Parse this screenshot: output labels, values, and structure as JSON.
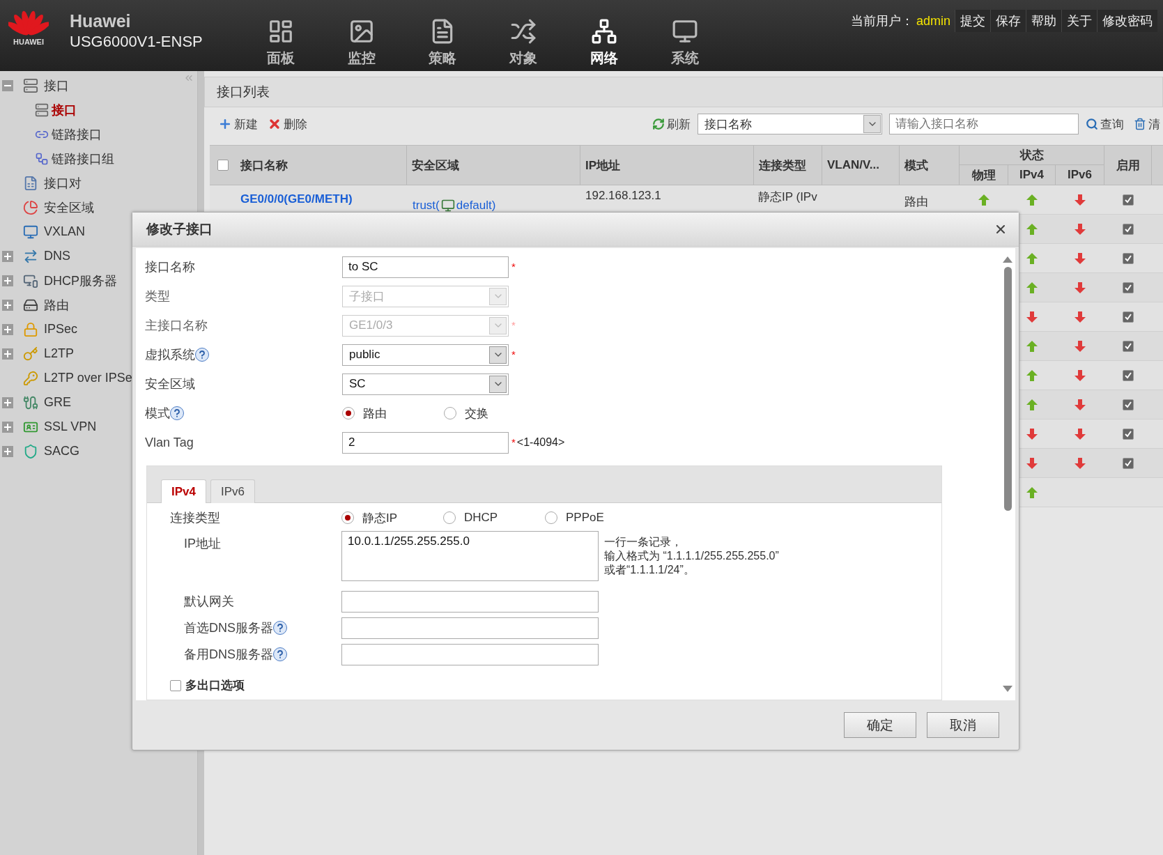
{
  "header": {
    "brand": "HUAWEI",
    "title": "Huawei",
    "model": "USG6000V1-ENSP",
    "nav": [
      {
        "label": "面板",
        "selected": false
      },
      {
        "label": "监控",
        "selected": false
      },
      {
        "label": "策略",
        "selected": false
      },
      {
        "label": "对象",
        "selected": false
      },
      {
        "label": "网络",
        "selected": true
      },
      {
        "label": "系统",
        "selected": false
      }
    ],
    "user_label": "当前用户：",
    "user": "admin",
    "links": [
      "提交",
      "保存",
      "帮助",
      "关于",
      "修改密码"
    ]
  },
  "sidebar": {
    "items": [
      {
        "label": "接口",
        "expanded": true,
        "selected": false,
        "children": [
          {
            "label": "接口",
            "selected": true
          },
          {
            "label": "链路接口",
            "selected": false
          },
          {
            "label": "链路接口组",
            "selected": false
          }
        ]
      },
      {
        "label": "接口对",
        "selected": false
      },
      {
        "label": "安全区域",
        "selected": false
      },
      {
        "label": "VXLAN",
        "selected": false
      },
      {
        "label": "DNS",
        "expanded": false,
        "selected": false
      },
      {
        "label": "DHCP服务器",
        "expanded": false,
        "selected": false
      },
      {
        "label": "路由",
        "expanded": false,
        "selected": false
      },
      {
        "label": "IPSec",
        "expanded": false,
        "selected": false
      },
      {
        "label": "L2TP",
        "expanded": false,
        "selected": false
      },
      {
        "label": "L2TP over IPSe",
        "selected": false
      },
      {
        "label": "GRE",
        "expanded": false,
        "selected": false
      },
      {
        "label": "SSL VPN",
        "expanded": false,
        "selected": false
      },
      {
        "label": "SACG",
        "expanded": false,
        "selected": false
      }
    ]
  },
  "panel": {
    "title": "接口列表",
    "toolbar": {
      "new": "新建",
      "delete": "删除",
      "refresh": "刷新",
      "filter": "接口名称",
      "search_placeholder": "请输入接口名称",
      "query": "查询",
      "clear": "清"
    },
    "table": {
      "select_all": {
        "checked": false
      },
      "columns": {
        "name": "接口名称",
        "zone": "安全区域",
        "ip": "IP地址",
        "conn_type": "连接类型",
        "vlan": "VLAN/V...",
        "mode": "模式",
        "status": "状态",
        "physical": "物理",
        "ipv4": "IPv4",
        "ipv6": "IPv6",
        "enabled": "启用"
      },
      "rows": [
        {
          "name": "GE0/0/0(GE0/METH)",
          "zone": "trust(",
          "zone_suffix": "default)",
          "ip": "192.168.123.1",
          "conn_type": "静态IP (IPv",
          "mode": "路由",
          "physical_up": true,
          "ipv4_up": true,
          "ipv6_up": false,
          "enabled": true
        },
        {
          "ipv4_up": true,
          "ipv6_up": false,
          "enabled": true
        },
        {
          "ipv4_up": true,
          "ipv6_up": false,
          "enabled": true
        },
        {
          "ipv4_up": true,
          "ipv6_up": false,
          "enabled": true
        },
        {
          "ipv4_up": false,
          "ipv6_up": false,
          "enabled": true
        },
        {
          "ipv4_up": true,
          "ipv6_up": false,
          "enabled": true
        },
        {
          "ipv4_up": true,
          "ipv6_up": false,
          "enabled": true
        },
        {
          "ipv4_up": true,
          "ipv6_up": false,
          "enabled": true
        },
        {
          "ipv4_up": false,
          "ipv6_up": false,
          "enabled": true
        },
        {
          "ipv4_up": false,
          "ipv6_up": false,
          "enabled": true
        },
        {
          "ipv4_up": true
        }
      ]
    }
  },
  "dialog": {
    "title": "修改子接口",
    "fields": [
      {
        "kind": "text",
        "label": "接口名称",
        "value": "to SC",
        "mark": "*"
      },
      {
        "kind": "select",
        "label": "类型",
        "value": "子接口",
        "disabled": true
      },
      {
        "kind": "select",
        "label": "主接口名称",
        "value": "GE1/0/3",
        "mark": "*",
        "disabled": true
      },
      {
        "kind": "select",
        "label": "虚拟系统",
        "value": "public",
        "mark": "*",
        "disabled": false,
        "help": true
      },
      {
        "kind": "select",
        "label": "安全区域",
        "value": "SC",
        "disabled": false
      },
      {
        "kind": "radio",
        "label": "模式",
        "help": true,
        "options": [
          {
            "label": "路由",
            "selected": true
          },
          {
            "label": "交换",
            "selected": false
          }
        ]
      },
      {
        "kind": "text",
        "label": "Vlan Tag",
        "value": "2",
        "mark": "*",
        "hint": "<1-4094>"
      }
    ],
    "tabs": [
      {
        "label": "IPv4",
        "selected": true
      },
      {
        "label": "IPv6",
        "selected": false
      }
    ],
    "connection": {
      "label": "连接类型",
      "options": [
        {
          "label": "静态IP",
          "selected": true
        },
        {
          "label": "DHCP",
          "selected": false
        },
        {
          "label": "PPPoE",
          "selected": false
        }
      ]
    },
    "ip": {
      "label": "IP地址",
      "value": "10.0.1.1/255.255.255.0",
      "note": [
        "一行一条记录，",
        "输入格式为 “1.1.1.1/255.255.255.0”",
        "或者“1.1.1.1/24”。"
      ]
    },
    "extra_fields": [
      {
        "label": "默认网关"
      },
      {
        "label": "首选DNS服务器",
        "help": true
      },
      {
        "label": "备用DNS服务器",
        "help": true
      }
    ],
    "multi_exit": {
      "label": "多出口选项",
      "checked": false
    },
    "buttons": [
      "确定",
      "取消"
    ]
  }
}
